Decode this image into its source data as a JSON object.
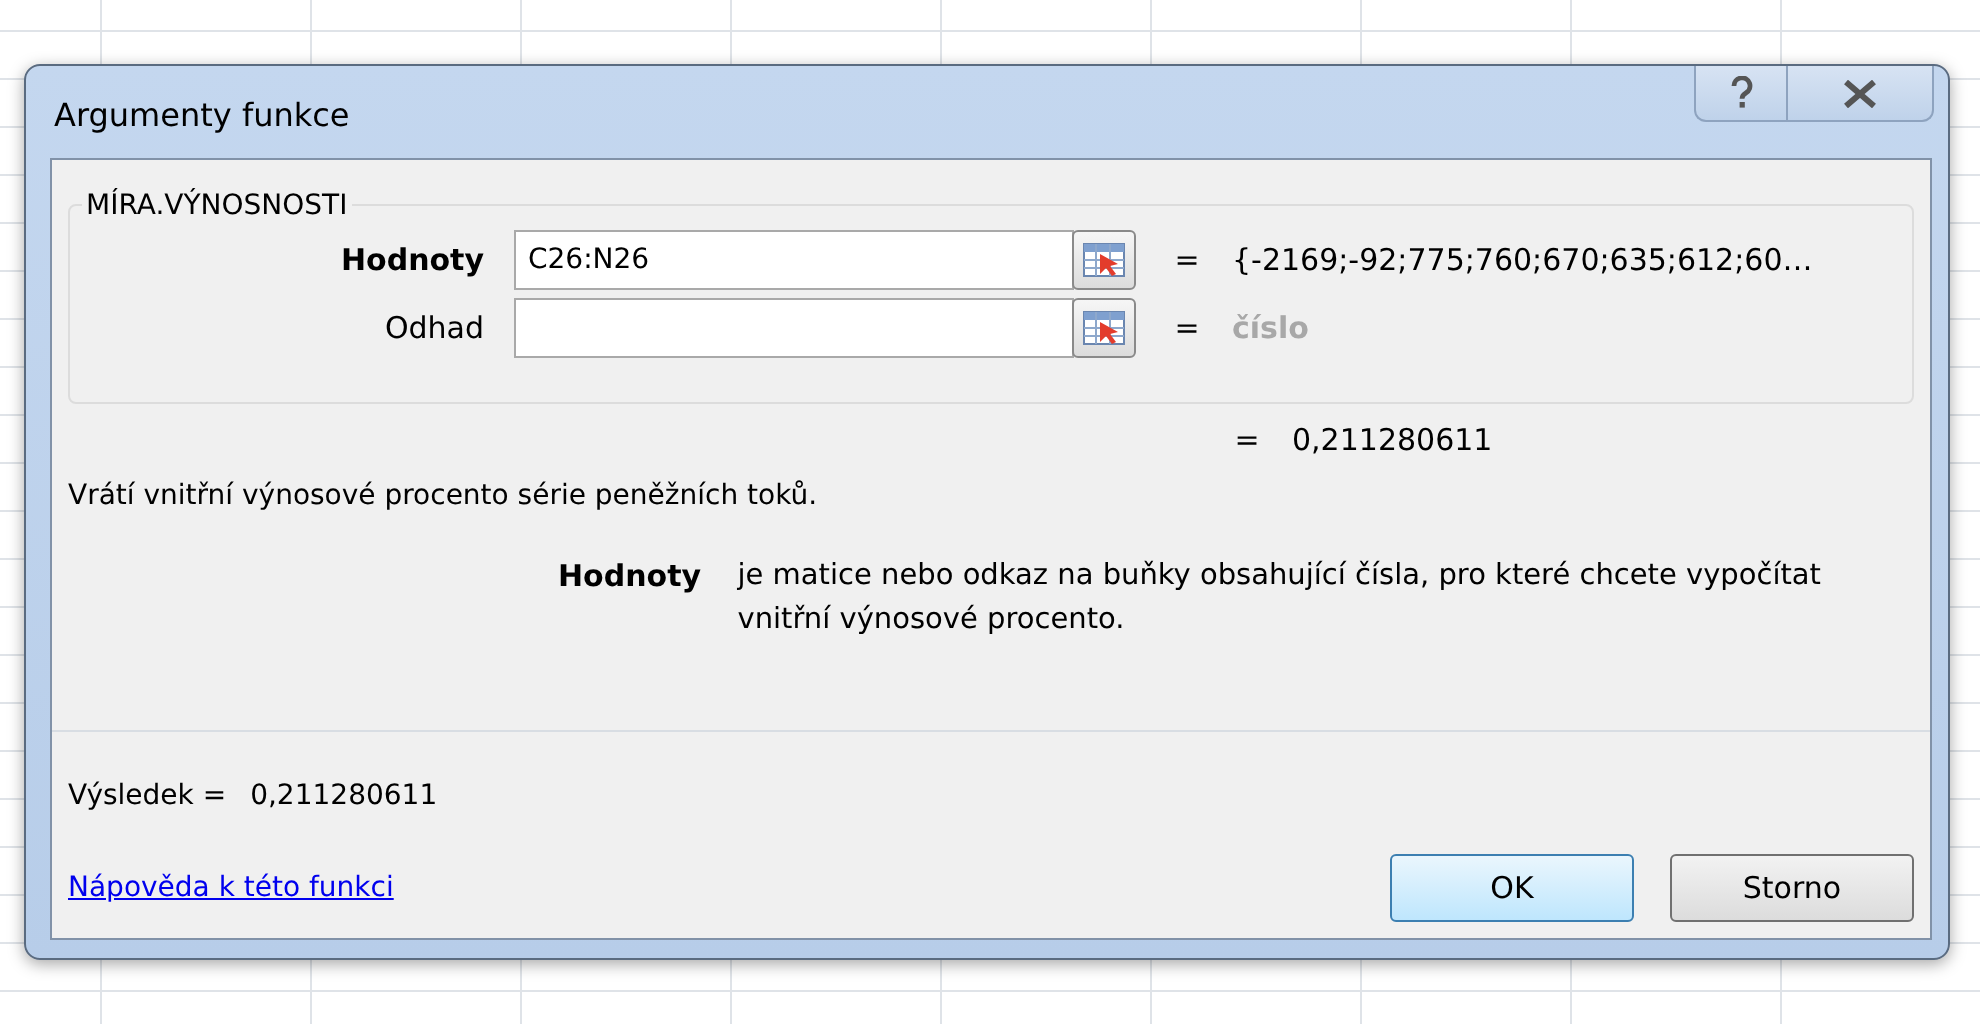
{
  "window": {
    "title": "Argumenty funkce"
  },
  "function": {
    "name": "MÍRA.VÝNOSNOSTI",
    "arguments": [
      {
        "label": "Hodnoty",
        "value": "C26:N26",
        "active": true,
        "kind": "filled",
        "equals": "=",
        "result": "{-2169;-92;775;760;670;635;612;60…"
      },
      {
        "label": "Odhad",
        "active": false,
        "kind": "empty",
        "equals": "=",
        "result": "číslo"
      }
    ]
  },
  "formula_result": {
    "equals": "=",
    "value": "0,211280611"
  },
  "description": "Vrátí vnitřní výnosové procento série peněžních toků.",
  "argument_help": {
    "argument": "Hodnoty",
    "text": "je matice nebo odkaz na buňky obsahující čísla, pro které chcete vypočítat vnitřní výnosové procento."
  },
  "result": {
    "label": "Výsledek =",
    "value": "0,211280611"
  },
  "help_link": "Nápověda k této funkci",
  "buttons": [
    {
      "label": "OK",
      "default": true
    },
    {
      "label": "Storno",
      "default": false
    }
  ]
}
